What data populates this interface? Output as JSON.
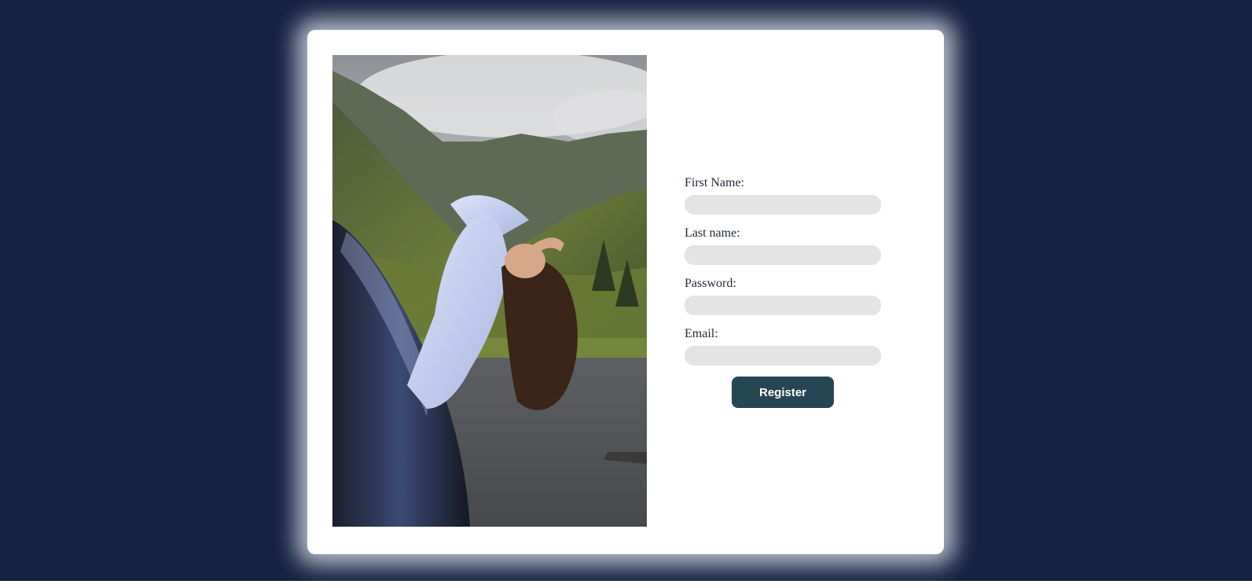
{
  "form": {
    "fields": [
      {
        "label": "First Name:",
        "value": "",
        "placeholder": ""
      },
      {
        "label": "Last name:",
        "value": "",
        "placeholder": ""
      },
      {
        "label": "Password:",
        "value": "",
        "placeholder": ""
      },
      {
        "label": "Email:",
        "value": "",
        "placeholder": ""
      }
    ],
    "register_label": "Register"
  },
  "colors": {
    "page_background": "#162340",
    "card_background": "#ffffff",
    "input_background": "#e4e4e4",
    "button_background": "#264653",
    "button_text": "#ffffff"
  }
}
